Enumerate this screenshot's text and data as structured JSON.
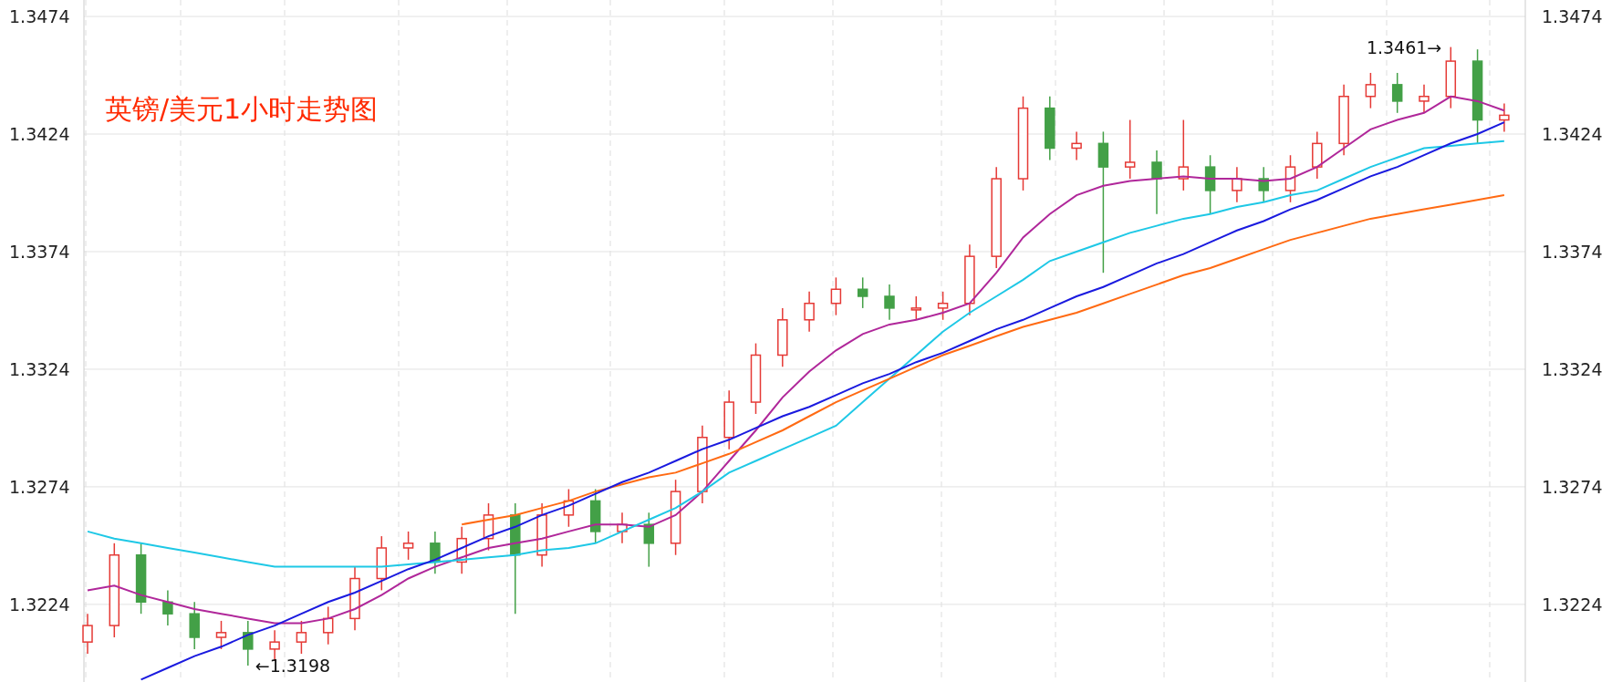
{
  "chart_data": {
    "type": "candlestick",
    "title": "英镑/美元1小时走势图",
    "grid": true,
    "ylim": [
      1.3191,
      1.3481
    ],
    "yticks": [
      1.3474,
      1.3424,
      1.3374,
      1.3324,
      1.3274,
      1.3224
    ],
    "ohlc": [
      [
        1.3208,
        1.322,
        1.3203,
        1.3215
      ],
      [
        1.3215,
        1.325,
        1.321,
        1.3245
      ],
      [
        1.3245,
        1.325,
        1.322,
        1.3225
      ],
      [
        1.3225,
        1.323,
        1.3215,
        1.322
      ],
      [
        1.322,
        1.3225,
        1.3205,
        1.321
      ],
      [
        1.321,
        1.3217,
        1.3205,
        1.3212
      ],
      [
        1.3212,
        1.3217,
        1.3198,
        1.3205
      ],
      [
        1.3205,
        1.3213,
        1.32,
        1.3208
      ],
      [
        1.3208,
        1.3217,
        1.3203,
        1.3212
      ],
      [
        1.3212,
        1.3223,
        1.3207,
        1.3218
      ],
      [
        1.3218,
        1.324,
        1.3213,
        1.3235
      ],
      [
        1.3235,
        1.3253,
        1.323,
        1.3248
      ],
      [
        1.3248,
        1.3255,
        1.3243,
        1.325
      ],
      [
        1.325,
        1.3255,
        1.3237,
        1.3242
      ],
      [
        1.3242,
        1.3257,
        1.3237,
        1.3252
      ],
      [
        1.3252,
        1.3267,
        1.3247,
        1.3262
      ],
      [
        1.3262,
        1.3267,
        1.322,
        1.3245
      ],
      [
        1.3245,
        1.3267,
        1.324,
        1.3262
      ],
      [
        1.3262,
        1.3273,
        1.3257,
        1.3268
      ],
      [
        1.3268,
        1.3273,
        1.325,
        1.3255
      ],
      [
        1.3255,
        1.3263,
        1.325,
        1.3258
      ],
      [
        1.3258,
        1.3263,
        1.324,
        1.325
      ],
      [
        1.325,
        1.3277,
        1.3245,
        1.3272
      ],
      [
        1.3272,
        1.33,
        1.3267,
        1.3295
      ],
      [
        1.3295,
        1.3315,
        1.329,
        1.331
      ],
      [
        1.331,
        1.3335,
        1.3305,
        1.333
      ],
      [
        1.333,
        1.335,
        1.3325,
        1.3345
      ],
      [
        1.3345,
        1.3357,
        1.334,
        1.3352
      ],
      [
        1.3352,
        1.3363,
        1.3347,
        1.3358
      ],
      [
        1.3358,
        1.3363,
        1.335,
        1.3355
      ],
      [
        1.3355,
        1.336,
        1.3345,
        1.335
      ],
      [
        1.335,
        1.3355,
        1.3345,
        1.335
      ],
      [
        1.335,
        1.3357,
        1.3345,
        1.3352
      ],
      [
        1.3352,
        1.3377,
        1.3347,
        1.3372
      ],
      [
        1.3372,
        1.341,
        1.3367,
        1.3405
      ],
      [
        1.3405,
        1.344,
        1.34,
        1.3435
      ],
      [
        1.3435,
        1.344,
        1.3413,
        1.3418
      ],
      [
        1.3418,
        1.3425,
        1.3413,
        1.342
      ],
      [
        1.342,
        1.3425,
        1.3365,
        1.341
      ],
      [
        1.341,
        1.343,
        1.3405,
        1.3412
      ],
      [
        1.3412,
        1.3417,
        1.339,
        1.3405
      ],
      [
        1.3405,
        1.343,
        1.34,
        1.341
      ],
      [
        1.341,
        1.3415,
        1.339,
        1.34
      ],
      [
        1.34,
        1.341,
        1.3395,
        1.3405
      ],
      [
        1.3405,
        1.341,
        1.3395,
        1.34
      ],
      [
        1.34,
        1.3415,
        1.3395,
        1.341
      ],
      [
        1.341,
        1.3425,
        1.3405,
        1.342
      ],
      [
        1.342,
        1.3445,
        1.3415,
        1.344
      ],
      [
        1.344,
        1.345,
        1.3435,
        1.3445
      ],
      [
        1.3445,
        1.345,
        1.3433,
        1.3438
      ],
      [
        1.3438,
        1.3445,
        1.3433,
        1.344
      ],
      [
        1.344,
        1.3461,
        1.3435,
        1.3455
      ],
      [
        1.3455,
        1.346,
        1.342,
        1.343
      ],
      [
        1.343,
        1.3437,
        1.3425,
        1.3432
      ]
    ],
    "series": [
      {
        "type": "line",
        "color": "#b0279a",
        "values": [
          1.323,
          1.3232,
          1.3228,
          1.3225,
          1.3222,
          1.322,
          1.3218,
          1.3216,
          1.3216,
          1.3218,
          1.3222,
          1.3228,
          1.3235,
          1.324,
          1.3244,
          1.3248,
          1.325,
          1.3252,
          1.3255,
          1.3258,
          1.3258,
          1.3257,
          1.3262,
          1.3272,
          1.3285,
          1.3298,
          1.3312,
          1.3323,
          1.3332,
          1.3339,
          1.3343,
          1.3345,
          1.3348,
          1.3352,
          1.3365,
          1.338,
          1.339,
          1.3398,
          1.3402,
          1.3404,
          1.3405,
          1.3406,
          1.3405,
          1.3405,
          1.3404,
          1.3405,
          1.341,
          1.3418,
          1.3426,
          1.343,
          1.3433,
          1.344,
          1.3438,
          1.3434
        ]
      },
      {
        "type": "line",
        "color": "#1ec8e6",
        "values": [
          1.3255,
          1.3252,
          1.325,
          1.3248,
          1.3246,
          1.3244,
          1.3242,
          1.324,
          1.324,
          1.324,
          1.324,
          1.324,
          1.3241,
          1.3242,
          1.3243,
          1.3244,
          1.3245,
          1.3247,
          1.3248,
          1.325,
          1.3255,
          1.326,
          1.3265,
          1.3272,
          1.328,
          1.3285,
          1.329,
          1.3295,
          1.33,
          1.331,
          1.332,
          1.333,
          1.334,
          1.3348,
          1.3355,
          1.3362,
          1.337,
          1.3374,
          1.3378,
          1.3382,
          1.3385,
          1.3388,
          1.339,
          1.3393,
          1.3395,
          1.3398,
          1.34,
          1.3405,
          1.341,
          1.3414,
          1.3418,
          1.3419,
          1.342,
          1.3421
        ]
      },
      {
        "type": "line",
        "color": "#ff6a13",
        "values": [
          null,
          null,
          null,
          null,
          null,
          null,
          null,
          null,
          null,
          null,
          null,
          null,
          null,
          null,
          1.3258,
          1.326,
          1.3262,
          1.3265,
          1.3268,
          1.3272,
          1.3275,
          1.3278,
          1.328,
          1.3284,
          1.3288,
          1.3293,
          1.3298,
          1.3304,
          1.331,
          1.3315,
          1.332,
          1.3325,
          1.333,
          1.3334,
          1.3338,
          1.3342,
          1.3345,
          1.3348,
          1.3352,
          1.3356,
          1.336,
          1.3364,
          1.3367,
          1.3371,
          1.3375,
          1.3379,
          1.3382,
          1.3385,
          1.3388,
          1.339,
          1.3392,
          1.3394,
          1.3396,
          1.3398
        ]
      },
      {
        "type": "line",
        "color": "#1a1adf",
        "values": [
          null,
          null,
          1.3192,
          1.3197,
          1.3202,
          1.3206,
          1.3211,
          1.3215,
          1.322,
          1.3225,
          1.3229,
          1.3234,
          1.3239,
          1.3243,
          1.3248,
          1.3253,
          1.3257,
          1.3262,
          1.3266,
          1.3271,
          1.3276,
          1.328,
          1.3285,
          1.329,
          1.3294,
          1.3299,
          1.3304,
          1.3308,
          1.3313,
          1.3318,
          1.3322,
          1.3327,
          1.3331,
          1.3336,
          1.3341,
          1.3345,
          1.335,
          1.3355,
          1.3359,
          1.3364,
          1.3369,
          1.3373,
          1.3378,
          1.3383,
          1.3387,
          1.3392,
          1.3396,
          1.3401,
          1.3406,
          1.341,
          1.3415,
          1.342,
          1.3424,
          1.3429
        ]
      }
    ],
    "annotations": [
      "1.3461→",
      "←1.3198"
    ]
  },
  "right_axis": {
    "ticks": [
      "1.3474",
      "1.3424",
      "1.3374",
      "1.3324",
      "1.3274",
      "1.3224"
    ]
  }
}
